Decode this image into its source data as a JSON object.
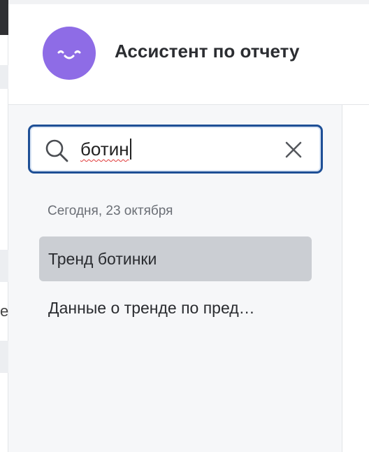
{
  "header": {
    "title": "Ассистент по отчету",
    "avatar_color": "#8e6ce6",
    "avatar_icon": "smiley-icon"
  },
  "search": {
    "value": "ботин",
    "icon": "search-icon",
    "clear_icon": "close-icon",
    "border_color": "#1e4f96"
  },
  "history": {
    "group_label": "Сегодня, 23 октября",
    "items": [
      {
        "label": "Тренд ботинки",
        "active": true
      },
      {
        "label": "Данные о тренде по пред…",
        "active": false
      }
    ]
  },
  "background_page": {
    "visible_char": "e"
  }
}
